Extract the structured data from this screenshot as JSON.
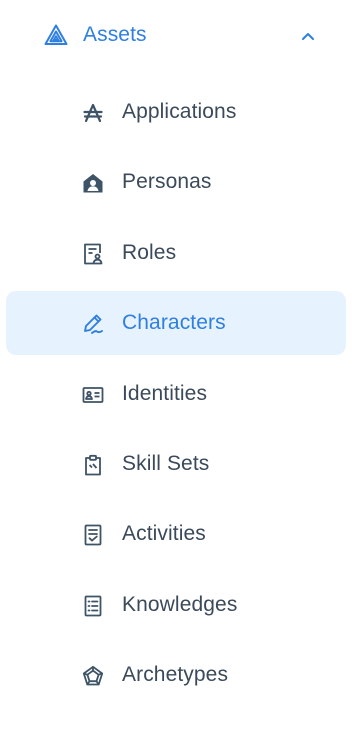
{
  "colors": {
    "accent": "#2f7fe0",
    "text": "#3b4a5a",
    "icon": "#3e5366",
    "active_bg": "#e6f2fd"
  },
  "section": {
    "label": "Assets",
    "icon": "triangle-layers-icon",
    "expanded": true
  },
  "items": [
    {
      "label": "Applications",
      "icon": "applications-icon",
      "active": false
    },
    {
      "label": "Personas",
      "icon": "persona-house-icon",
      "active": false
    },
    {
      "label": "Roles",
      "icon": "role-document-icon",
      "active": false
    },
    {
      "label": "Characters",
      "icon": "pen-signature-icon",
      "active": true
    },
    {
      "label": "Identities",
      "icon": "id-card-icon",
      "active": false
    },
    {
      "label": "Skill Sets",
      "icon": "clipboard-icon",
      "active": false
    },
    {
      "label": "Activities",
      "icon": "checklist-icon",
      "active": false
    },
    {
      "label": "Knowledges",
      "icon": "list-document-icon",
      "active": false
    },
    {
      "label": "Archetypes",
      "icon": "pentagon-icon",
      "active": false
    }
  ]
}
